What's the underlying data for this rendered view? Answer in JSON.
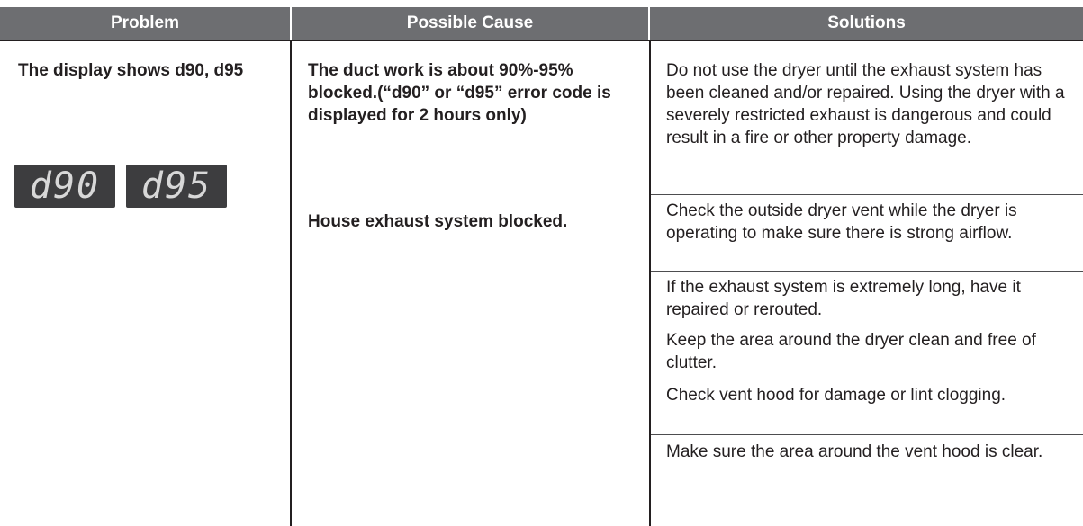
{
  "headers": {
    "problem": "Problem",
    "cause": "Possible Cause",
    "solutions": "Solutions"
  },
  "problem": {
    "text": "The display shows d90, d95",
    "display_codes": [
      "d90",
      "d95"
    ]
  },
  "causes": [
    "The duct work is about 90%-95% blocked.(“d90” or “d95” error code is displayed for 2 hours only)",
    "House exhaust system blocked."
  ],
  "solutions": [
    "Do not use the dryer until the exhaust system has been cleaned and/or repaired. Using the dryer with a severely restricted exhaust is dangerous and could result in a fire or other property damage.",
    "Check the outside dryer vent while the dryer is operating to make sure there is strong airflow.",
    "If the exhaust system is extremely long, have it repaired or rerouted.",
    "Keep the area around the dryer clean and free of clutter.",
    "Check vent hood for damage or lint clogging.",
    "Make sure the area around the vent hood is clear."
  ],
  "colors": {
    "header_bg": "#6d6e71",
    "header_text": "#ffffff",
    "body_text": "#231f20",
    "display_bg": "#3d3d3f",
    "display_segments": "#d8d8d8"
  }
}
